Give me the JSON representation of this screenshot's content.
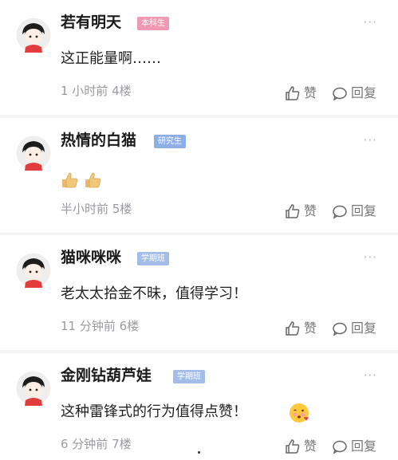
{
  "colors": {
    "badge_undergrad": "#ef9ab2",
    "badge_grad": "#8eaee6",
    "badge_study": "#a3bde8"
  },
  "comments": [
    {
      "name": "若有明天",
      "badge": "本科生",
      "text": "这正能量啊……",
      "meta": "1 小时前  4楼",
      "like_label": "赞",
      "reply_label": "回复",
      "more": "···"
    },
    {
      "name": "热情的白猫",
      "badge": "研究生",
      "text": "",
      "emoji": "thumbs-up-emoji ×2",
      "meta": "半小时前  5楼",
      "like_label": "赞",
      "reply_label": "回复",
      "more": "···"
    },
    {
      "name": "猫咪咪咪",
      "badge": "学期班",
      "text": "老太太拾金不昧，值得学习！",
      "meta": "11 分钟前  6楼",
      "like_label": "赞",
      "reply_label": "回复",
      "more": "···"
    },
    {
      "name": "金刚钻葫芦娃",
      "badge": "学期班",
      "text": "这种雷锋式的行为值得点赞！",
      "emoji": "blowing-kiss-emoji",
      "meta": "6 分钟前  7楼",
      "like_label": "赞",
      "reply_label": "回复",
      "more": "···"
    }
  ]
}
